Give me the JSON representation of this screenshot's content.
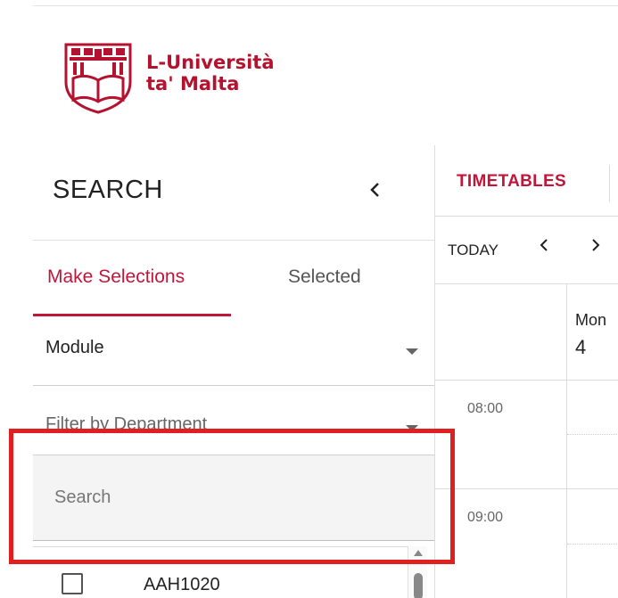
{
  "brand": {
    "name_line1": "L-Università",
    "name_line2": "ta' Malta",
    "color": "#b5122f"
  },
  "search_panel": {
    "title": "SEARCH",
    "collapse_icon": "chevron-left-icon",
    "tabs": [
      {
        "label": "Make Selections",
        "active": true
      },
      {
        "label": "Selected",
        "active": false
      }
    ],
    "type_select": {
      "value": "Module"
    },
    "department_select": {
      "placeholder": "Filter by Department"
    },
    "search": {
      "placeholder": "Search",
      "value": ""
    },
    "results": [
      {
        "code": "AAH1020",
        "checked": false
      }
    ]
  },
  "timetable": {
    "tab_label": "TIMETABLES",
    "today_label": "TODAY",
    "prev_icon": "chevron-left-icon",
    "next_icon": "chevron-right-icon",
    "day": {
      "name": "Mon",
      "number": "4"
    },
    "times": [
      "08:00",
      "09:00"
    ]
  },
  "colors": {
    "accent": "#c1163a",
    "highlight": "#e02020"
  }
}
